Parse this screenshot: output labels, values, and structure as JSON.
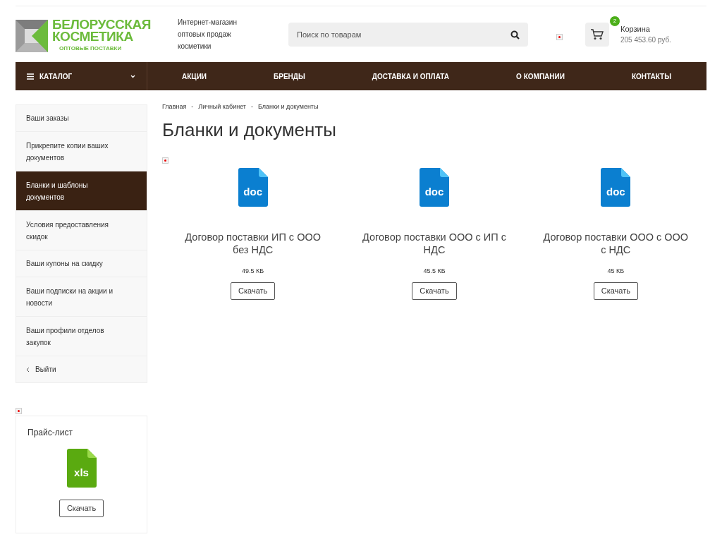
{
  "header": {
    "logo": {
      "line1": "БЕЛОРУССКАЯ",
      "line2": "КОСМЕТИКА",
      "tagline": "ОПТОВЫЕ ПОСТАВКИ"
    },
    "slogan": [
      "Интернет-магазин",
      "оптовых продаж",
      "косметики"
    ],
    "search": {
      "placeholder": "Поиск по товарам"
    },
    "cart": {
      "count": "2",
      "label": "Корзина",
      "total": "205 453.60 руб."
    }
  },
  "nav": {
    "catalog": "КАТАЛОГ",
    "items": [
      "АКЦИИ",
      "БРЕНДЫ",
      "ДОСТАВКА И ОПЛАТА",
      "О КОМПАНИИ",
      "КОНТАКТЫ"
    ]
  },
  "sidebar": {
    "items": [
      {
        "label": "Ваши заказы",
        "selected": false
      },
      {
        "label": "Прикрепите копии ваших документов",
        "selected": false
      },
      {
        "label": "Бланки и шаблоны документов",
        "selected": true
      },
      {
        "label": "Условия предоставления скидок",
        "selected": false
      },
      {
        "label": "Ваши купоны на скидку",
        "selected": false
      },
      {
        "label": "Ваши подписки на акции и новости",
        "selected": false
      },
      {
        "label": "Ваши профили отделов закупок",
        "selected": false
      }
    ],
    "logout": "Выйти"
  },
  "price_list": {
    "title": "Прайс-лист",
    "file_type": "xls",
    "button": "Скачать"
  },
  "breadcrumbs": [
    "Главная",
    "Личный кабинет",
    "Бланки и документы"
  ],
  "breadcrumb_separator": "-",
  "title": "Бланки и документы",
  "documents": [
    {
      "file_type": "doc",
      "name": "Договор поставки ИП с ООО без НДС",
      "size": "49.5 КБ",
      "button": "Скачать"
    },
    {
      "file_type": "doc",
      "name": "Договор поставки ООО с ИП с НДС",
      "size": "45.5 КБ",
      "button": "Скачать"
    },
    {
      "file_type": "doc",
      "name": "Договор поставки ООО с ООО с НДС",
      "size": "45 КБ",
      "button": "Скачать"
    }
  ]
}
